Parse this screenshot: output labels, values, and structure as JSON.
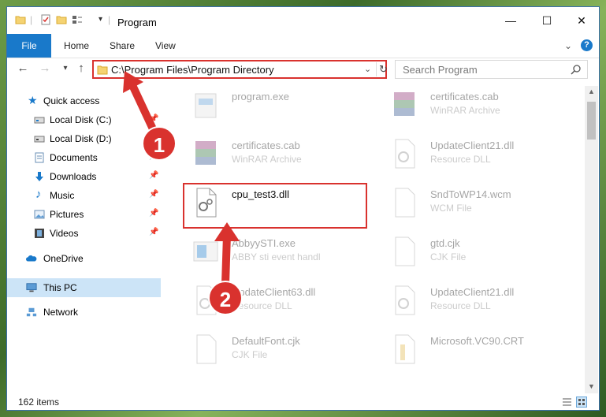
{
  "window": {
    "title": "Program",
    "controls": {
      "minimize": "—",
      "maximize": "☐",
      "close": "✕"
    }
  },
  "ribbon": {
    "file_label": "File",
    "tabs": [
      "Home",
      "Share",
      "View"
    ]
  },
  "navbar": {
    "address_value": "C:\\Program Files\\Program Directory",
    "search_placeholder": "Search Program"
  },
  "nav_pane": {
    "items": [
      {
        "label": "Quick access",
        "icon": "star-icon",
        "pinned": false
      },
      {
        "label": "Local Disk (C:)",
        "icon": "drive-icon",
        "pinned": true
      },
      {
        "label": "Local Disk (D:)",
        "icon": "drive-icon",
        "pinned": false
      },
      {
        "label": "Documents",
        "icon": "documents-icon",
        "pinned": true
      },
      {
        "label": "Downloads",
        "icon": "download-icon",
        "pinned": true
      },
      {
        "label": "Music",
        "icon": "music-icon",
        "pinned": true
      },
      {
        "label": "Pictures",
        "icon": "pictures-icon",
        "pinned": true
      },
      {
        "label": "Videos",
        "icon": "video-icon",
        "pinned": true
      },
      {
        "label": "OneDrive",
        "icon": "cloud-icon",
        "pinned": false
      },
      {
        "label": "This PC",
        "icon": "pc-icon",
        "pinned": false
      },
      {
        "label": "Network",
        "icon": "network-icon",
        "pinned": false
      }
    ]
  },
  "files": [
    {
      "name": "program.exe",
      "type": "",
      "icon": "exe-icon"
    },
    {
      "name": "certificates.cab",
      "type": "WinRAR Archive",
      "icon": "winrar-icon"
    },
    {
      "name": "certificates.cab",
      "type": "WinRAR Archive",
      "icon": "winrar-icon"
    },
    {
      "name": "UpdateClient21.dll",
      "type": "Resource DLL",
      "icon": "dll-icon"
    },
    {
      "name": "cpu_test3.dll",
      "type": "",
      "icon": "dll-gear-icon"
    },
    {
      "name": "SndToWP14.wcm",
      "type": "WCM File",
      "icon": "file-icon"
    },
    {
      "name": "AbbyySTI.exe",
      "type": "ABBY sti event handl",
      "icon": "exe-icon"
    },
    {
      "name": "gtd.cjk",
      "type": "CJK File",
      "icon": "file-icon"
    },
    {
      "name": "UpdateClient63.dll",
      "type": "Resource DLL",
      "icon": "dll-icon"
    },
    {
      "name": "UpdateClient21.dll",
      "type": "Resource DLL",
      "icon": "dll-icon"
    },
    {
      "name": "DefaultFont.cjk",
      "type": "CJK File",
      "icon": "file-icon"
    },
    {
      "name": "Microsoft.VC90.CRT",
      "type": "",
      "icon": "folder-icon"
    }
  ],
  "status": {
    "item_count": "162 items"
  },
  "annotations": {
    "step1": "1",
    "step2": "2",
    "accent": "#d9322e"
  }
}
